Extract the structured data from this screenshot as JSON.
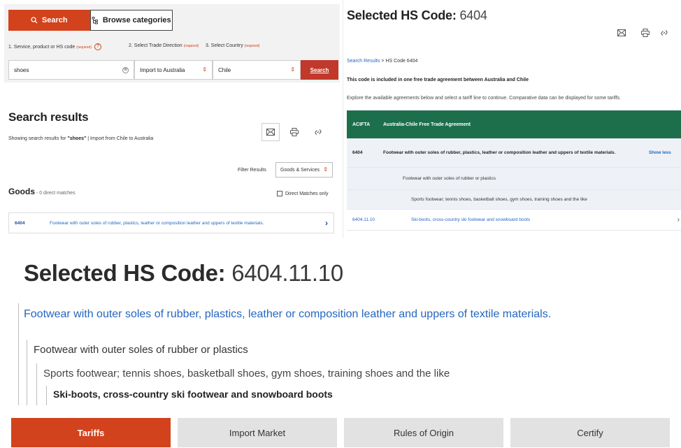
{
  "search_panel": {
    "tab_search": "Search",
    "tab_browse": "Browse categories",
    "label_service": "1. Service, product or HS code",
    "label_direction": "2. Select Trade Direction",
    "label_country": "3. Select Country",
    "required": "(required)",
    "help_glyph": "?",
    "query_value": "shoes",
    "clear_glyph": "⊗",
    "direction_value": "Import to Australia",
    "country_value": "Chile",
    "submit_label": "Search"
  },
  "results": {
    "title": "Search results",
    "summary_prefix": "Showing search results for ",
    "summary_query": "\"shoes\"",
    "summary_suffix": " | Import from Chile to Australia",
    "filter_label": "Filter Results",
    "filter_value": "Goods & Services",
    "goods_heading": "Goods",
    "goods_count": " - 0 direct matches",
    "direct_matches_label": "Direct Matches only",
    "rows": [
      {
        "code": "6404",
        "description": "Footwear with outer soles of rubber, plastics, leather or composition leather and uppers of textile materials."
      }
    ]
  },
  "hs_panel": {
    "title_label": "Selected HS Code:",
    "title_code": "6404",
    "breadcrumb_link": "Search Results",
    "breadcrumb_rest": " > HS Code 6404",
    "agreement_note": "This code is included in one free trade agreement between Australia and Chile",
    "explore_note": "Explore the available agreements below and select a tariff line to continue. Comparative data can be displayed for some tariffs.",
    "table_header_code": "ACIFTA",
    "table_header_name": "Australia-Chile Free Trade Agreement",
    "row1_code": "6404",
    "row1_desc": "Footwear with outer soles of rubber, plastics, leather or composition leather and uppers of textile materials.",
    "row1_more": "Show less",
    "row2_desc": "Footwear with outer soles of rubber or plastics",
    "row3_desc": "Sports footwear; tennis shoes, basketball shoes, gym shoes, training shoes and the like",
    "row4_code": "6404.11.10",
    "row4_desc": "Ski-boots, cross-country ski footwear and snowboard boots"
  },
  "selected": {
    "title_label": "Selected HS Code:",
    "title_code": "6404.11.10",
    "level1": "Footwear with outer soles of rubber, plastics, leather or composition leather and uppers of textile materials.",
    "level2": "Footwear with outer soles of rubber or plastics",
    "level3": "Sports footwear; tennis shoes, basketball shoes, gym shoes, training shoes and the like",
    "level4": "Ski-boots, cross-country ski footwear and snowboard boots"
  },
  "bottom_tabs": {
    "tariffs": "Tariffs",
    "import_market": "Import Market",
    "rules_of_origin": "Rules of Origin",
    "certify": "Certify"
  },
  "colors": {
    "accent": "#d2421c",
    "table_header": "#1d6f4c",
    "link": "#2466c2"
  },
  "icons": [
    "search-icon",
    "browse-tree-icon",
    "help-icon",
    "clear-icon",
    "updown-icon",
    "email-icon",
    "print-icon",
    "link-icon",
    "chevron-right-icon"
  ]
}
